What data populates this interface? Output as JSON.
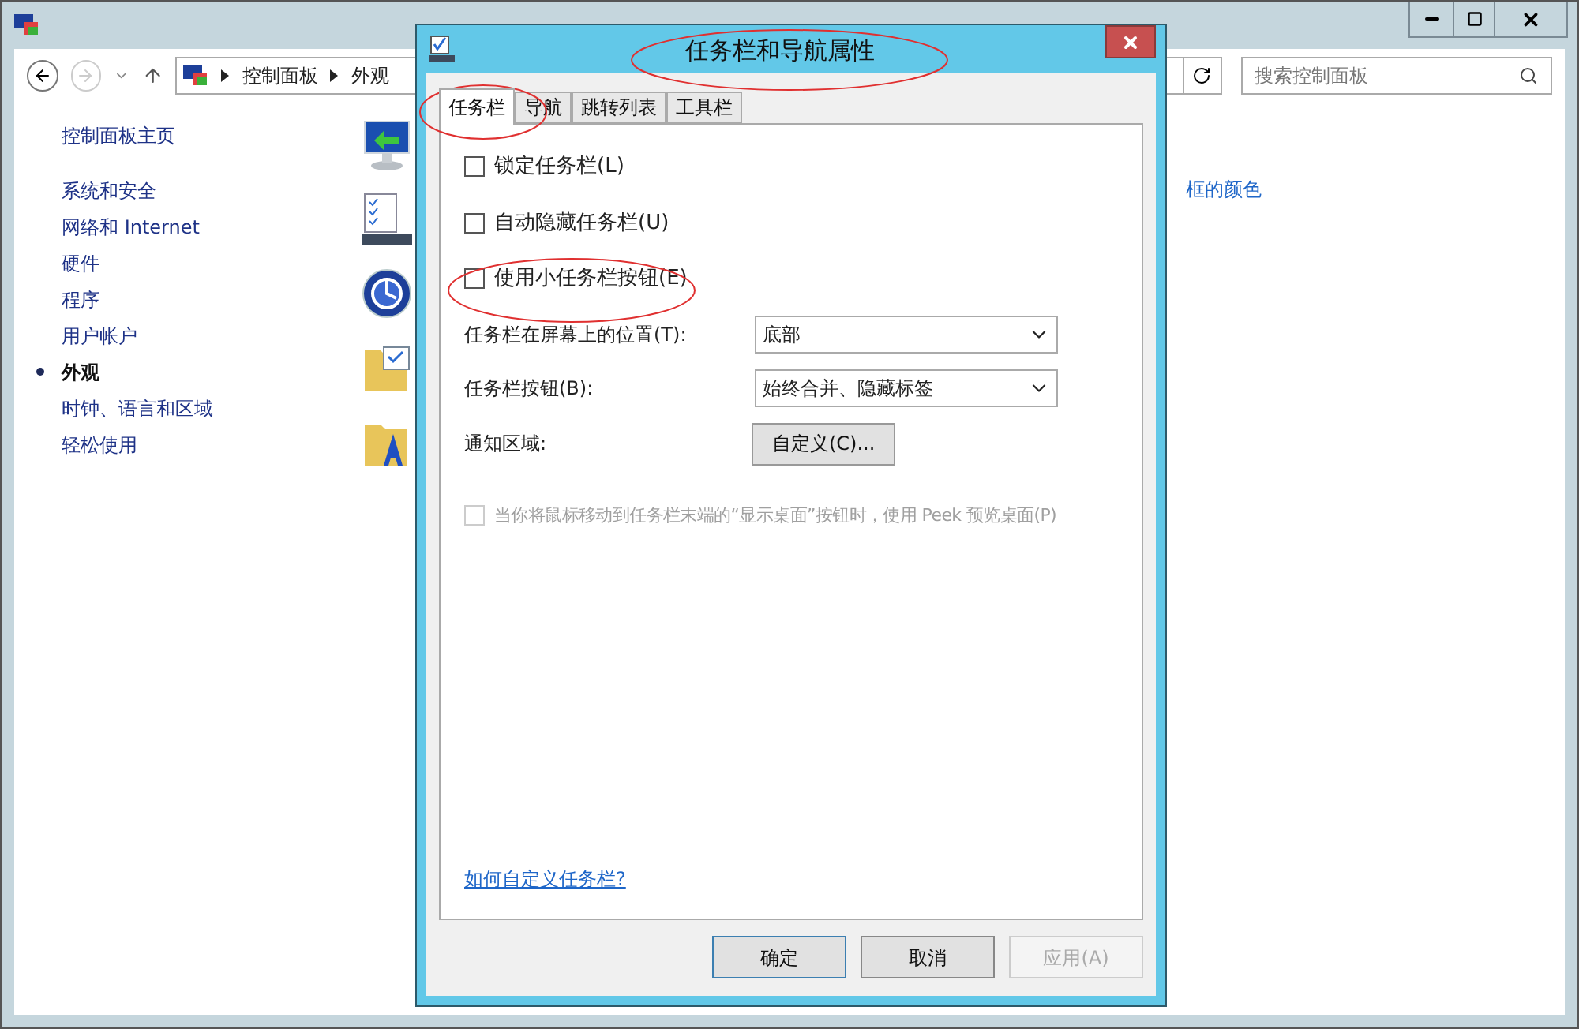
{
  "explorer": {
    "breadcrumb": [
      "控制面板",
      "外观"
    ],
    "search": {
      "placeholder": "搜索控制面板"
    },
    "sidebar": {
      "home": "控制面板主页",
      "items": [
        {
          "label": "系统和安全",
          "selected": false
        },
        {
          "label": "网络和 Internet",
          "selected": false
        },
        {
          "label": "硬件",
          "selected": false
        },
        {
          "label": "程序",
          "selected": false
        },
        {
          "label": "用户帐户",
          "selected": false
        },
        {
          "label": "外观",
          "selected": true
        },
        {
          "label": "时钟、语言和区域",
          "selected": false
        },
        {
          "label": "轻松使用",
          "selected": false
        }
      ]
    },
    "content_link": "框的颜色"
  },
  "dialog": {
    "title": "任务栏和导航属性",
    "tabs": [
      {
        "label": "任务栏",
        "selected": true
      },
      {
        "label": "导航",
        "selected": false
      },
      {
        "label": "跳转列表",
        "selected": false
      },
      {
        "label": "工具栏",
        "selected": false
      }
    ],
    "checkboxes": [
      {
        "label": "锁定任务栏(L)",
        "checked": false,
        "disabled": false
      },
      {
        "label": "自动隐藏任务栏(U)",
        "checked": false,
        "disabled": false
      },
      {
        "label": "使用小任务栏按钮(E)",
        "checked": false,
        "disabled": false
      }
    ],
    "dropdowns": [
      {
        "label": "任务栏在屏幕上的位置(T):",
        "value": "底部"
      },
      {
        "label": "任务栏按钮(B):",
        "value": "始终合并、隐藏标签"
      }
    ],
    "notification": {
      "label": "通知区域:",
      "button": "自定义(C)..."
    },
    "peek": {
      "label": "当你将鼠标移动到任务栏末端的“显示桌面”按钮时，使用 Peek 预览桌面(P)",
      "checked": false,
      "disabled": true
    },
    "help_link": "如何自定义任务栏?",
    "buttons": [
      {
        "label": "确定",
        "disabled": false,
        "default": true
      },
      {
        "label": "取消",
        "disabled": false,
        "default": false
      },
      {
        "label": "应用(A)",
        "disabled": true,
        "default": false
      }
    ]
  }
}
